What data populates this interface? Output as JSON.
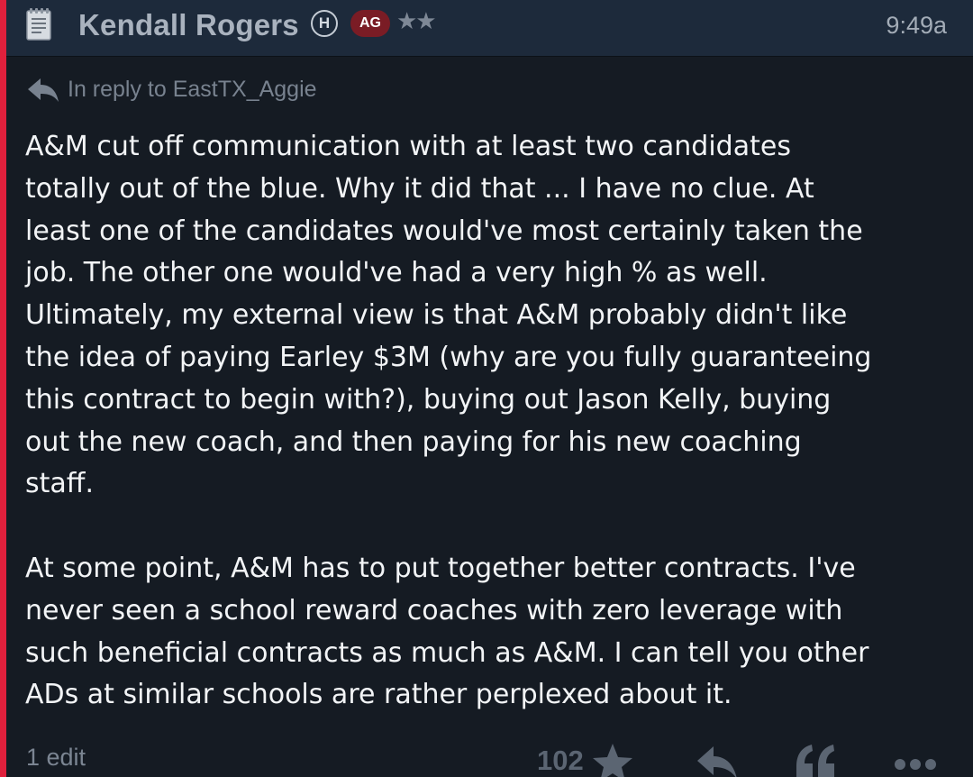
{
  "post": {
    "author": "Kendall Rogers",
    "badge_h": "H",
    "badge_ag": "AG",
    "rating_stars": "★★",
    "time": "9:49a",
    "reply_to": "In reply to EastTX_Aggie",
    "paragraphs": [
      "A&M cut off communication with at least two candidates\ntotally out of the blue. Why it did that ... I have no clue. At\nleast one of the candidates would've most certainly taken the\njob. The other one would've had a very high % as well.\nUltimately, my external view is that A&M probably didn't like\nthe idea of paying Earley $3M (why are you fully guaranteeing\nthis contract to begin with?), buying out Jason Kelly, buying\nout the new coach, and then paying for his new coaching\nstaff.",
      "At some point, A&M has to put together better contracts. I've\nnever seen a school reward coaches with zero leverage with\nsuch beneficial contracts as much as A&M. I can tell you other\nADs at similar schools are rather perplexed about it."
    ],
    "edits": "1 edit",
    "like_count": "102"
  },
  "icons": {
    "header": "document-icon",
    "reply_indicator": "reply-arrow-icon",
    "like": "star-icon",
    "reply": "reply-icon",
    "quote": "quote-icon",
    "more": "more-options-icon"
  },
  "colors": {
    "accent": "#e0203c",
    "header_bg": "#1d2a3b",
    "body_bg": "#151b23",
    "ag_badge": "#7a1c25",
    "text": "#f2f4f6",
    "muted": "#78828f"
  }
}
